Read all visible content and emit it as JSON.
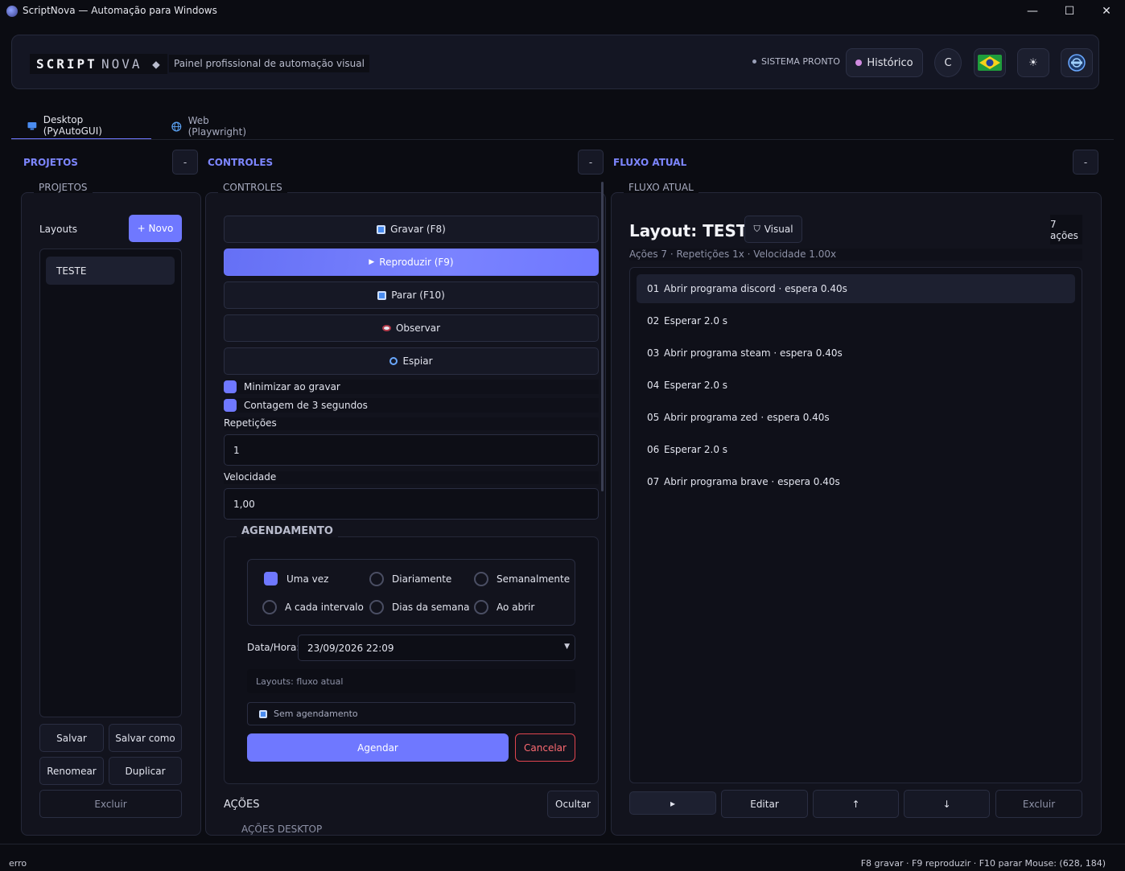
{
  "window": {
    "title": "ScriptNova — Automação para Windows",
    "minimize": "—",
    "maximize": "☐",
    "close": "✕"
  },
  "header": {
    "logo_script": "SCRIPT",
    "logo_nova": "NOVA ◆",
    "subtitle": "Painel profissional de automação visual",
    "status": "SISTEMA PRONTO",
    "history_label": "Histórico",
    "c_label": "C",
    "theme_icon": "☀"
  },
  "tabs": [
    {
      "label": "Desktop (PyAutoGUI)",
      "icon": "monitor-icon"
    },
    {
      "label": "Web (Playwright)",
      "icon": "globe-icon"
    }
  ],
  "sections": {
    "projetos": "PROJETOS",
    "controles": "CONTROLES",
    "fluxo": "FLUXO ATUAL",
    "collapse": "-"
  },
  "projetos": {
    "panel_label": "PROJETOS",
    "layouts_label": "Layouts",
    "new_label": "+ Novo",
    "items": [
      "TESTE"
    ],
    "save": "Salvar",
    "save_as": "Salvar como",
    "rename": "Renomear",
    "duplicate": "Duplicar",
    "delete": "Excluir"
  },
  "controles": {
    "panel_label": "CONTROLES",
    "record": "Gravar  (F8)",
    "play": "Reproduzir  (F9)",
    "stop": "Parar  (F10)",
    "observe": "Observar",
    "spy": "Espiar",
    "minimize_on_record": "Minimizar ao gravar",
    "countdown": "Contagem de 3 segundos",
    "repetitions_label": "Repetições",
    "repetitions_value": "1",
    "speed_label": "Velocidade",
    "speed_value": "1,00",
    "schedule": {
      "title": "AGENDAMENTO",
      "options": [
        "Uma vez",
        "Diariamente",
        "Semanalmente",
        "A cada intervalo",
        "Dias da semana",
        "Ao abrir"
      ],
      "datetime_label": "Data/Hora:",
      "datetime_value": "23/09/2026  22:09",
      "layouts_hint": "Layouts: fluxo atual",
      "no_schedule": "Sem agendamento",
      "schedule_btn": "Agendar",
      "cancel_btn": "Cancelar"
    },
    "actions_label": "AÇÕES",
    "hide_label": "Ocultar",
    "desktop_actions_label": "AÇÕES DESKTOP"
  },
  "fluxo": {
    "panel_label": "FLUXO ATUAL",
    "layout_title": "Layout: TESTE",
    "visual_label": "Visual",
    "count_label": "7 ações",
    "meta": "Ações 7  ·  Repetições 1x  ·  Velocidade 1.00x",
    "rows": [
      {
        "num": "01",
        "text": "Abrir programa discord  ·  espera 0.40s"
      },
      {
        "num": "02",
        "text": "Esperar 2.0 s"
      },
      {
        "num": "03",
        "text": "Abrir programa steam  ·  espera 0.40s"
      },
      {
        "num": "04",
        "text": "Esperar 2.0 s"
      },
      {
        "num": "05",
        "text": "Abrir programa zed  ·  espera 0.40s"
      },
      {
        "num": "06",
        "text": "Esperar 2.0 s"
      },
      {
        "num": "07",
        "text": "Abrir programa brave  ·  espera 0.40s"
      }
    ],
    "run_btn": "▸",
    "edit_btn": "Editar",
    "up_btn": "↑",
    "down_btn": "↓",
    "delete_btn": "Excluir"
  },
  "statusbar": {
    "left": "erro",
    "right": "F8 gravar · F9 reproduzir · F10 parar  Mouse: (628, 184)"
  },
  "colors": {
    "accent": "#6f78ff",
    "background": "#0b0c12",
    "panel": "#12131d",
    "danger": "#e0454f"
  }
}
